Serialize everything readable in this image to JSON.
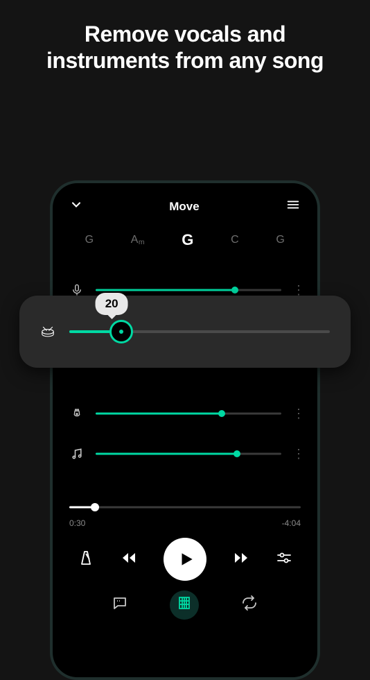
{
  "headline": "Remove vocals and instruments from any song",
  "app": {
    "title": "Move"
  },
  "chords": {
    "items": [
      "G",
      "Am",
      "G",
      "C",
      "G"
    ],
    "current_index": 2
  },
  "tracks": {
    "vocals": {
      "icon": "mic",
      "value_pct": 75
    },
    "drums": {
      "icon": "drums",
      "value_pct": 20,
      "tooltip": "20"
    },
    "guitar": {
      "icon": "guitar",
      "value_pct": 68
    },
    "other": {
      "icon": "music",
      "value_pct": 76
    }
  },
  "playback": {
    "progress_pct": 11,
    "elapsed": "0:30",
    "remaining": "-4:04"
  },
  "bottom_tabs": {
    "active_index": 1
  }
}
